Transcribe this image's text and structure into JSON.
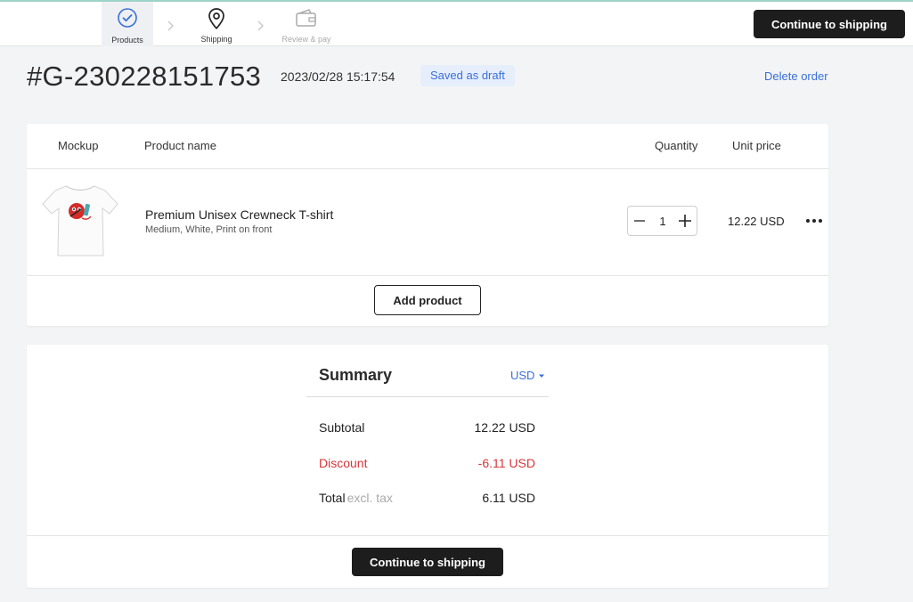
{
  "steps": [
    {
      "label": "Products",
      "icon": "check-circle-icon",
      "state": "active"
    },
    {
      "label": "Shipping",
      "icon": "map-pin-icon",
      "state": "next"
    },
    {
      "label": "Review & pay",
      "icon": "wallet-icon",
      "state": "disabled"
    }
  ],
  "header": {
    "continue_label": "Continue to shipping"
  },
  "order": {
    "id": "#G-230228151753",
    "date": "2023/02/28 15:17:54",
    "status": "Saved as draft",
    "delete_label": "Delete order"
  },
  "table": {
    "columns": [
      "Mockup",
      "Product name",
      "Quantity",
      "Unit price"
    ]
  },
  "items": [
    {
      "name": "Premium Unisex Crewneck T-shirt",
      "variant": "Medium, White, Print on front",
      "quantity": "1",
      "unit_price": "12.22 USD"
    }
  ],
  "add_product_label": "Add product",
  "summary": {
    "title": "Summary",
    "currency": "USD",
    "subtotal_label": "Subtotal",
    "subtotal_value": "12.22 USD",
    "discount_label": "Discount",
    "discount_value": "-6.11 USD",
    "total_label": "Total",
    "total_note": "excl. tax",
    "total_value": "6.11 USD",
    "continue_label": "Continue to shipping"
  },
  "colors": {
    "accent": "#3a6fd8",
    "primary_button": "#1d1d1d",
    "discount": "#d8353a",
    "badge_bg": "#e6eefc"
  }
}
